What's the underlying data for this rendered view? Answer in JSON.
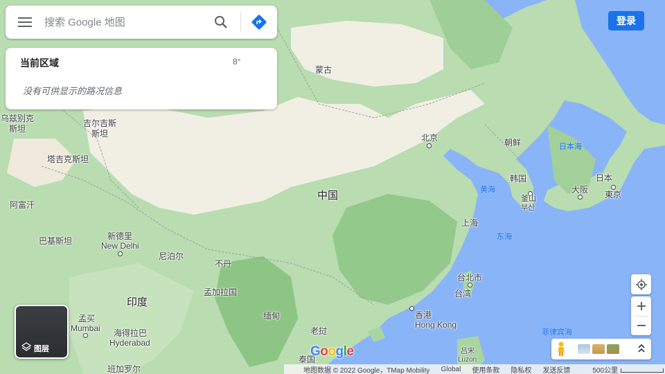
{
  "search": {
    "placeholder": "搜索 Google 地图"
  },
  "traffic": {
    "title": "当前区域",
    "temp": "8°",
    "note": "没有可供显示的路况信息"
  },
  "signin": {
    "label": "登录"
  },
  "layers": {
    "label": "图层"
  },
  "map_labels": {
    "mongolia": "蒙古",
    "uzbek": "乌兹别克\n斯坦",
    "kyrgyz": "吉尔吉斯\n斯坦",
    "tajik": "塔吉克斯坦",
    "afghan": "阿富汗",
    "pakistan": "巴基斯坦",
    "newdelhi_cn": "新德里",
    "newdelhi_en": "New Delhi",
    "nepal": "尼泊尔",
    "bhutan": "不丹",
    "india": "印度",
    "bangladesh": "孟加拉国",
    "myanmar": "缅甸",
    "laos": "老挝",
    "thailand": "泰国",
    "mumbai_cn": "孟买",
    "mumbai_en": "Mumbai",
    "hyderabad_cn": "海得拉巴",
    "hyderabad_en": "Hyderabad",
    "bangalore": "班加罗尔",
    "china": "中国",
    "beijing": "北京",
    "shanghai": "上海",
    "hongkong_cn": "香港",
    "hongkong_en": "Hong Kong",
    "taipei": "台北市",
    "taiwan": "台湾",
    "philippines_cn": "吕宋",
    "philippines_en": "Luzon",
    "philippine_sea": "菲律宾海",
    "nkorea": "朝鲜",
    "skorea": "韩国",
    "busan": "釜山\n부산",
    "japan": "日本",
    "osaka": "大阪",
    "tokyo_cn": "日本",
    "tokyo": "東京",
    "yellow_sea": "黄海",
    "east_sea": "东海",
    "sea_of_japan": "日本海"
  },
  "logo": [
    "G",
    "o",
    "o",
    "g",
    "l",
    "e"
  ],
  "footer": {
    "attribution": "地图数据 © 2022 Google，TMap Mobility",
    "global": "Global",
    "terms": "使用条款",
    "privacy": "隐私权",
    "feedback": "发送反馈",
    "scale": "500公里"
  },
  "colors": {
    "ocean": "#8ab4f8",
    "land_green": "#a8d5a2",
    "land_desert": "#f1efe4",
    "accent": "#1a73e8"
  }
}
